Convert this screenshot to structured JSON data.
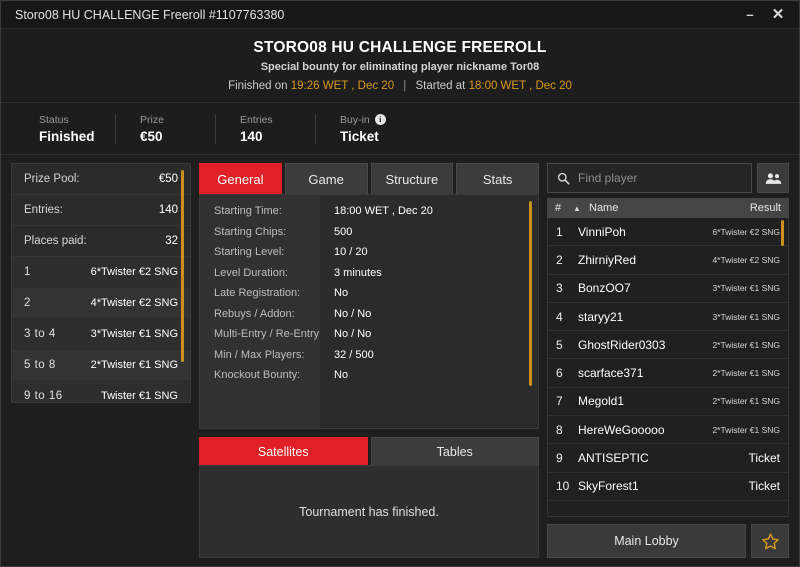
{
  "titlebar": {
    "title": "Storo08 HU CHALLENGE Freeroll #1107763380",
    "minimize_label": "–",
    "close_label": "✕"
  },
  "header": {
    "title": "STORO08 HU CHALLENGE FREEROLL",
    "subtitle": "Special bounty for eliminating player nickname Tor08",
    "finished_prefix": "Finished on",
    "finished_time": "19:26 WET , Dec 20",
    "separator": "|",
    "started_prefix": "Started at",
    "started_time": "18:00 WET , Dec 20"
  },
  "status_strip": [
    {
      "label": "Status",
      "value": "Finished",
      "has_info": false
    },
    {
      "label": "Prize",
      "value": "€50",
      "has_info": false
    },
    {
      "label": "Entries",
      "value": "140",
      "has_info": false
    },
    {
      "label": "Buy-in",
      "value": "Ticket",
      "has_info": true,
      "info_glyph": "i"
    }
  ],
  "prize_panel": {
    "info_rows": [
      {
        "label": "Prize Pool:",
        "value": "€50"
      },
      {
        "label": "Entries:",
        "value": "140"
      },
      {
        "label": "Places paid:",
        "value": "32"
      }
    ],
    "payouts": [
      {
        "place": "1",
        "award": "6*Twister €2 SNG"
      },
      {
        "place": "2",
        "award": "4*Twister €2 SNG"
      },
      {
        "place": "3  to  4",
        "award": "3*Twister €1 SNG"
      },
      {
        "place": "5  to  8",
        "award": "2*Twister €1 SNG"
      },
      {
        "place": "9  to  16",
        "award": "Twister €1 SNG"
      }
    ]
  },
  "tabs": [
    {
      "label": "General",
      "active": true
    },
    {
      "label": "Game",
      "active": false
    },
    {
      "label": "Structure",
      "active": false
    },
    {
      "label": "Stats",
      "active": false
    }
  ],
  "general": {
    "rows": [
      {
        "label": "Starting Time:",
        "value": "18:00 WET , Dec 20"
      },
      {
        "label": "Starting Chips:",
        "value": "500"
      },
      {
        "label": "Starting Level:",
        "value": "10 / 20"
      },
      {
        "label": "Level Duration:",
        "value": "3 minutes"
      },
      {
        "label": "Late Registration:",
        "value": "No"
      },
      {
        "label": "Rebuys / Addon:",
        "value": "No / No"
      },
      {
        "label": "Multi-Entry / Re-Entry:",
        "value": "No / No"
      },
      {
        "label": "Min / Max Players:",
        "value": "32 / 500"
      },
      {
        "label": "Knockout Bounty:",
        "value": "No"
      }
    ]
  },
  "sub_tabs": [
    {
      "label": "Satellites",
      "active": true
    },
    {
      "label": "Tables",
      "active": false
    }
  ],
  "satellites": {
    "empty_message": "Tournament has finished."
  },
  "player_search": {
    "placeholder": "Find player",
    "search_icon": "search-icon",
    "people_icon": "people-icon"
  },
  "player_table": {
    "headers": {
      "num": "#",
      "sort": "▲",
      "name": "Name",
      "result": "Result"
    },
    "rows": [
      {
        "num": "1",
        "name": "VinniPoh",
        "result": "6*Twister €2 SNG",
        "big": false
      },
      {
        "num": "2",
        "name": "ZhirniyRed",
        "result": "4*Twister €2 SNG",
        "big": false
      },
      {
        "num": "3",
        "name": "BonzOO7",
        "result": "3*Twister €1 SNG",
        "big": false
      },
      {
        "num": "4",
        "name": "staryy21",
        "result": "3*Twister €1 SNG",
        "big": false
      },
      {
        "num": "5",
        "name": "GhostRider0303",
        "result": "2*Twister €1 SNG",
        "big": false
      },
      {
        "num": "6",
        "name": "scarface371",
        "result": "2*Twister €1 SNG",
        "big": false
      },
      {
        "num": "7",
        "name": "Megold1",
        "result": "2*Twister €1 SNG",
        "big": false
      },
      {
        "num": "8",
        "name": "HereWeGooooo",
        "result": "2*Twister €1 SNG",
        "big": false
      },
      {
        "num": "9",
        "name": "ANTISEPTIC",
        "result": "Ticket",
        "big": true
      },
      {
        "num": "10",
        "name": "SkyForest1",
        "result": "Ticket",
        "big": true
      }
    ]
  },
  "footer": {
    "main_lobby_label": "Main Lobby",
    "favorite_icon": "star-icon"
  },
  "colors": {
    "accent_red": "#e01f26",
    "accent_gold": "#d99a1a",
    "scrollbar_gold": "#c9901c",
    "window_bg": "#1e1e1e",
    "panel_bg": "#2b2b2b"
  }
}
